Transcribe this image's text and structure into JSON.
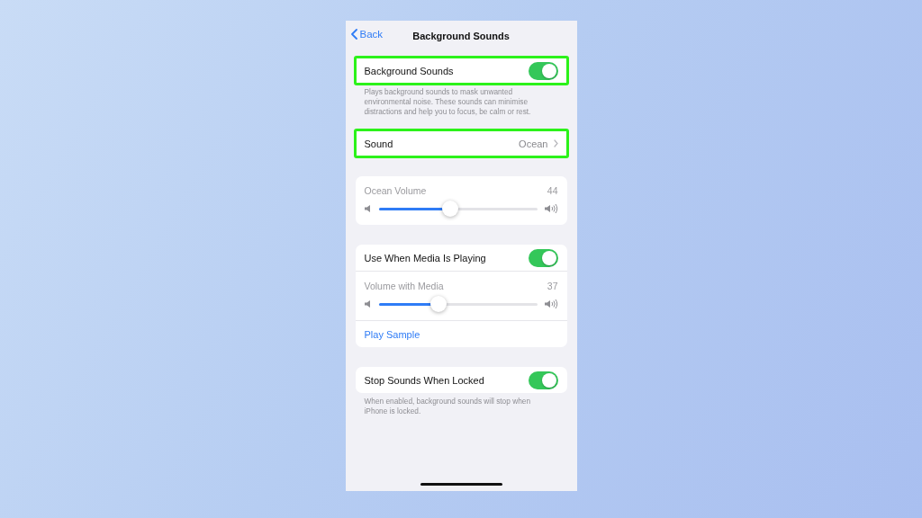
{
  "nav": {
    "back": "Back",
    "title": "Background Sounds"
  },
  "sections": [
    {
      "rows": [
        {
          "kind": "toggle",
          "label": "Background Sounds",
          "on": true,
          "highlighted": true
        }
      ],
      "footer": "Plays background sounds to mask unwanted environmental noise. These sounds can minimise distractions and help you to focus, be calm or rest."
    },
    {
      "rows": [
        {
          "kind": "link",
          "label": "Sound",
          "value": "Ocean",
          "highlighted": true
        }
      ]
    },
    {
      "rows": [
        {
          "kind": "slider",
          "label": "Ocean Volume",
          "reading": "44",
          "level": 0.45
        }
      ]
    },
    {
      "rows": [
        {
          "kind": "toggle",
          "label": "Use When Media Is Playing",
          "on": true,
          "highlighted": false
        },
        {
          "kind": "slider",
          "label": "Volume with Media",
          "reading": "37",
          "level": 0.38
        },
        {
          "kind": "action",
          "label": "Play Sample"
        }
      ]
    },
    {
      "rows": [
        {
          "kind": "toggle",
          "label": "Stop Sounds When Locked",
          "on": true,
          "highlighted": false
        }
      ],
      "footer": "When enabled, background sounds will stop when iPhone is locked."
    }
  ]
}
